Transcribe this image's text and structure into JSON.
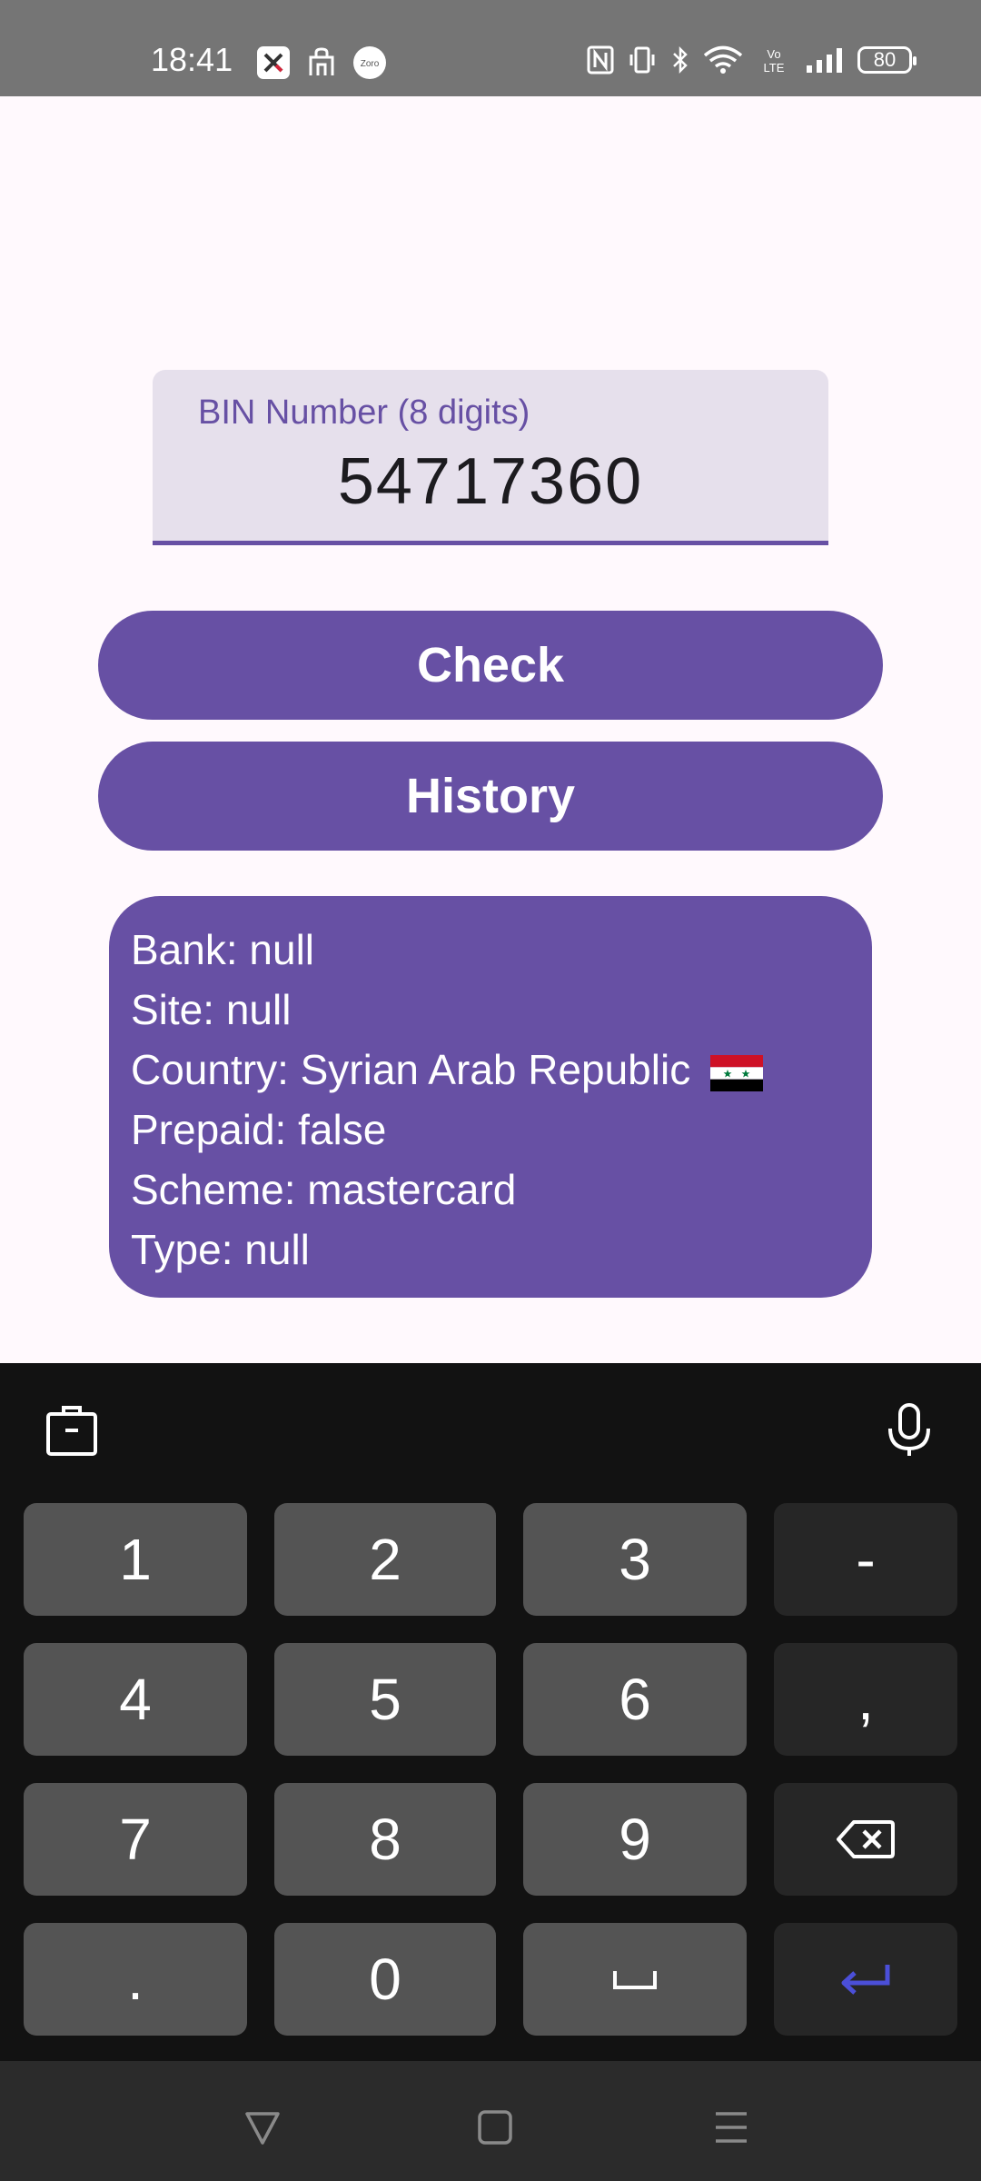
{
  "status_bar": {
    "time": "18:41",
    "left_icons": [
      "x-app-icon",
      "bag-icon",
      "zoro-icon"
    ],
    "zoro_text": "Zoro",
    "right_icons": [
      "nfc-icon",
      "vibrate-icon",
      "bluetooth-icon",
      "wifi-icon",
      "volte-icon",
      "signal-icon"
    ],
    "volte_text": "Vo LTE",
    "battery": "80"
  },
  "form": {
    "bin_label": "BIN Number (8 digits)",
    "bin_value": "54717360"
  },
  "buttons": {
    "check": "Check",
    "history": "History"
  },
  "result": {
    "bank": "Bank: null",
    "site": "Site: null",
    "country": "Country: Syrian Arab Republic",
    "country_flag": "syria-flag-icon",
    "prepaid": "Prepaid: false",
    "scheme": "Scheme: mastercard",
    "type": "Type: null"
  },
  "keyboard": {
    "toolbar": [
      "clipboard-icon",
      "microphone-icon"
    ],
    "rows": [
      [
        "1",
        "2",
        "3",
        "-"
      ],
      [
        "4",
        "5",
        "6",
        ","
      ],
      [
        "7",
        "8",
        "9",
        "backspace-icon"
      ],
      [
        ".",
        "0",
        "space-icon",
        "enter-icon"
      ]
    ]
  },
  "nav_bar": [
    "back-icon",
    "home-icon",
    "recents-icon"
  ],
  "colors": {
    "primary": "#6750A4",
    "field_bg": "#E6E0EC",
    "background": "#FFF9FD",
    "keyboard_bg": "#121212",
    "key_bg": "#545454",
    "key_dark_bg": "#262626",
    "enter_icon": "#4B4FD8"
  }
}
